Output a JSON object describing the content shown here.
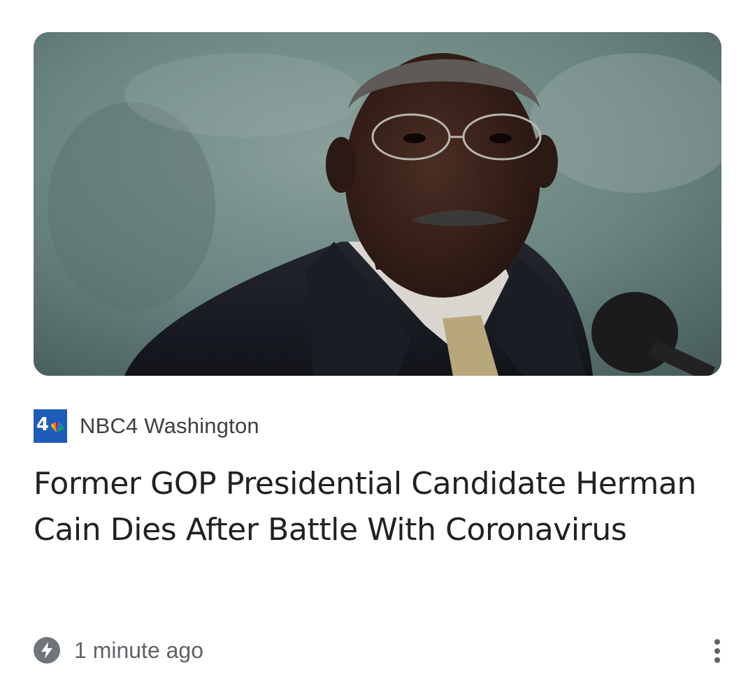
{
  "article": {
    "image_alt": "Herman Cain at a press conference",
    "source": {
      "logo_text": "4",
      "name": "NBC4 Washington"
    },
    "headline": "Former GOP Presidential Candidate Herman Cain Dies After Battle With Coronavirus",
    "timestamp": "1 minute ago",
    "timestamp_icon": "bolt-icon",
    "more_icon": "more-vert-icon"
  },
  "colors": {
    "logo_blue": "#1f5bb8",
    "headline": "#202124",
    "secondary_text": "#5f6368"
  }
}
